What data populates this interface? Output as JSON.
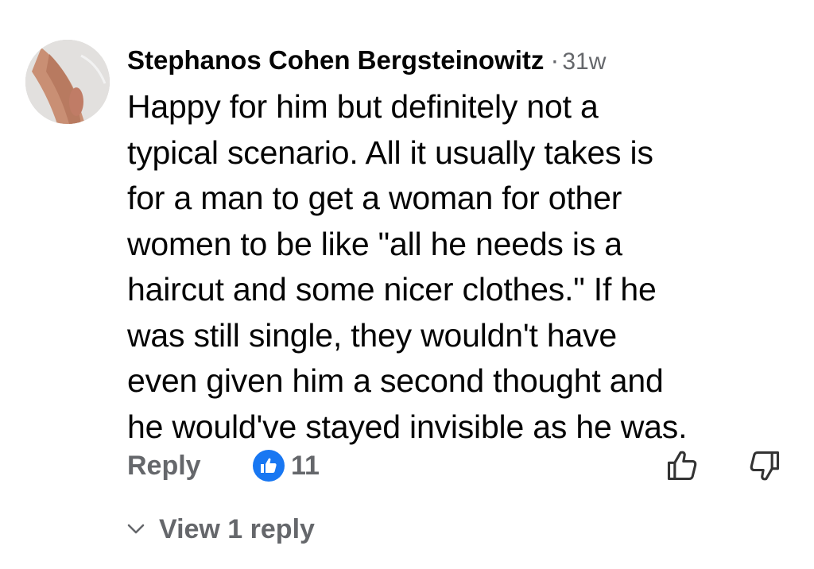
{
  "comment": {
    "author": "Stephanos Cohen Bergsteinowitz",
    "separator": "·",
    "timestamp": "31w",
    "lines": [
      "Happy for him but definitely not a",
      "typical scenario. All it usually takes is",
      "for a man to get a woman for other",
      "women to be like \"all he needs is a",
      "haircut and some nicer clothes.\" If he",
      "was still single, they wouldn't have",
      "even given him a second thought and",
      "he would've stayed invisible as he was."
    ]
  },
  "actions": {
    "reply_label": "Reply",
    "reaction_icon": "like-thumb-icon",
    "reaction_count": "11",
    "upvote_icon": "thumbs-up-outline-icon",
    "downvote_icon": "thumbs-down-outline-icon"
  },
  "replies": {
    "icon": "chevron-down-icon",
    "label": "View 1 reply"
  },
  "colors": {
    "text_primary": "#050505",
    "text_secondary": "#65676b",
    "like_blue": "#1877f2",
    "background": "#ffffff"
  }
}
